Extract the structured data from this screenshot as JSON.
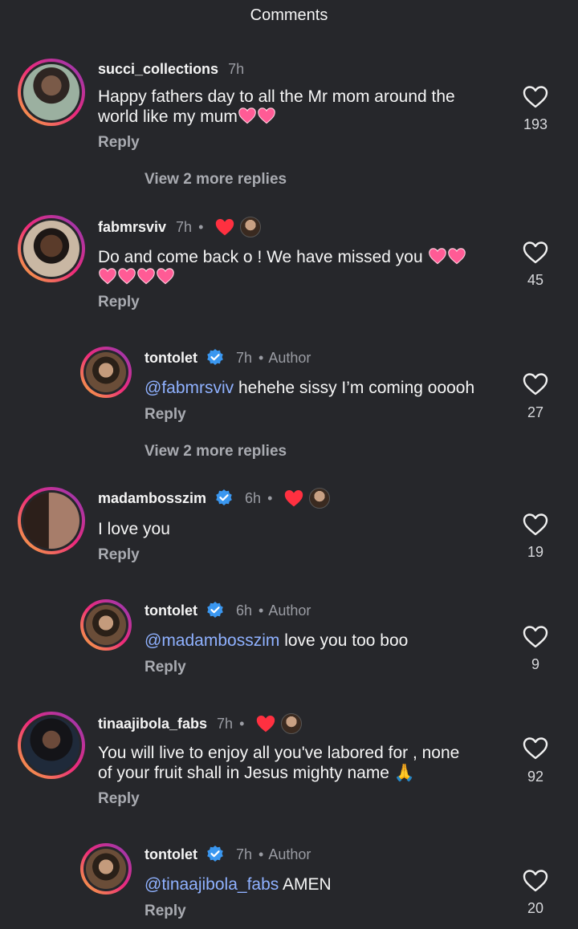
{
  "header": {
    "title": "Comments"
  },
  "reply_label": "Reply",
  "author_label": "Author",
  "dot": "•",
  "comments": [
    {
      "username": "succi_collections",
      "time": "7h",
      "text_line1": "Happy fathers day to all the Mr mom around the",
      "text_line2": "world like my mum",
      "likes": "193",
      "view_more": "View 2 more replies"
    },
    {
      "username": "fabmrsviv",
      "time": "7h",
      "text_line1": "Do and come back o ! We have missed you",
      "likes": "45"
    },
    {
      "username": "tontolet",
      "time": "7h",
      "mention": "@fabmrsviv",
      "text": " hehehe sissy I’m coming ooooh",
      "likes": "27",
      "view_more": "View 2 more replies"
    },
    {
      "username": "madambosszim",
      "time": "6h",
      "text_line1": "I love you",
      "likes": "19"
    },
    {
      "username": "tontolet",
      "time": "6h",
      "mention": "@madambosszim",
      "text": " love you too boo",
      "likes": "9"
    },
    {
      "username": "tinaajibola_fabs",
      "time": "7h",
      "text_line1": "You will live to enjoy all you've labored for , none",
      "text_line2": "of your fruit shall in Jesus mighty name 🙏",
      "likes": "92"
    },
    {
      "username": "tontolet",
      "time": "7h",
      "mention": "@tinaajibola_fabs",
      "text": " AMEN",
      "likes": "20"
    }
  ],
  "colors": {
    "background": "#26272b",
    "mention": "#8fb1ff",
    "verified": "#3a97f0",
    "heart_red": "#ff3040",
    "emoji_pink": "#ff5b95"
  },
  "icons": [
    "heart-outline-icon",
    "verified-badge-icon",
    "liked-by-author-heart-icon"
  ]
}
